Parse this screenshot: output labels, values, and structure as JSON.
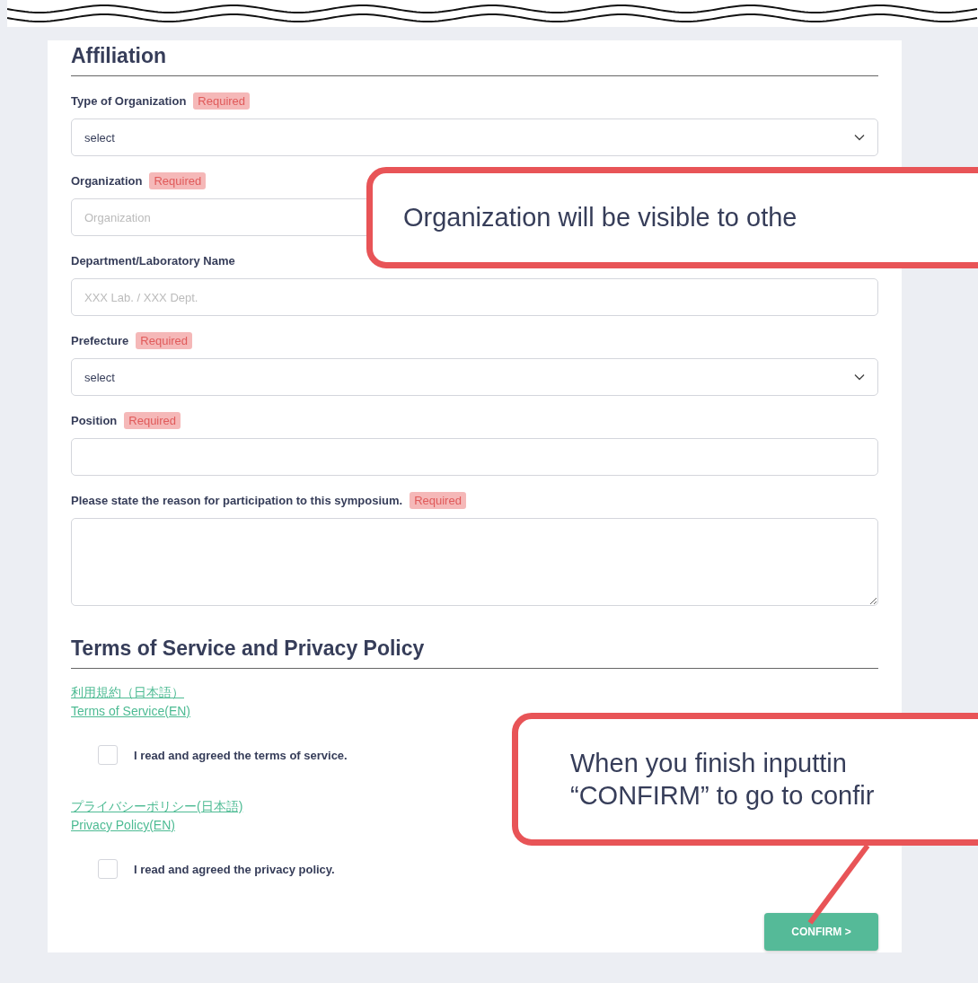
{
  "sections": [
    {
      "title": "Affiliation"
    }
  ],
  "fields": [
    {
      "kind": "select",
      "label": "Type of Organization",
      "required_badge": "Required",
      "value": "select"
    },
    {
      "kind": "text",
      "label": "Organization",
      "required_badge": "Required",
      "placeholder": "Organization"
    },
    {
      "kind": "text",
      "label": "Department/Laboratory Name",
      "placeholder": "XXX Lab. / XXX Dept."
    },
    {
      "kind": "select",
      "label": "Prefecture",
      "required_badge": "Required",
      "value": "select"
    },
    {
      "kind": "text",
      "label": "Position",
      "required_badge": "Required"
    },
    {
      "kind": "textarea",
      "label": "Please state the reason for participation to this symposium.",
      "required_badge": "Required"
    }
  ],
  "terms": {
    "title": "Terms of Service and Privacy Policy",
    "groups": [
      {
        "links": [
          "利用規約（日本語）",
          "Terms of Service(EN)"
        ],
        "agreement": {
          "label": "I read and agreed the terms of service.",
          "checked": false
        }
      },
      {
        "links": [
          "プライバシーポリシー(日本語)",
          "Privacy Policy(EN)"
        ],
        "agreement": {
          "label": "I read and agreed the privacy policy.",
          "checked": false
        }
      }
    ]
  },
  "confirm_button": "CONFIRM >",
  "callouts": [
    {
      "text": "Organization will be visible to othe"
    },
    {
      "text": "When you finish inputtin\n“CONFIRM” to go to confir"
    }
  ]
}
